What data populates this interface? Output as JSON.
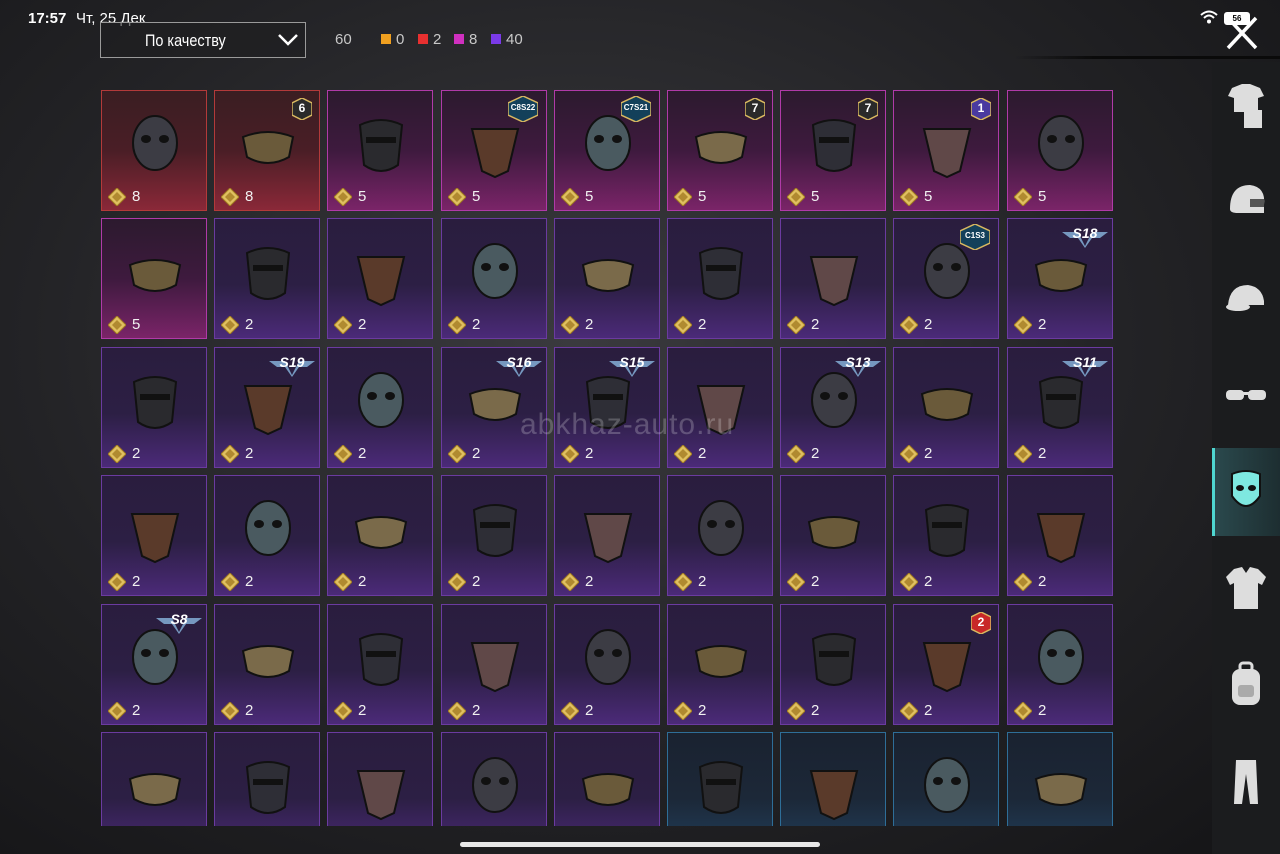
{
  "status_bar": {
    "time": "17:57",
    "date": "Чт, 25 Дек",
    "battery": "56"
  },
  "sort": {
    "label": "По качеству"
  },
  "counts": {
    "total": "60",
    "legendary": "0",
    "red": "2",
    "pink": "8",
    "purple": "40",
    "colors": {
      "legendary": "#f0a020",
      "red": "#e83030",
      "pink": "#d030c0",
      "purple": "#7a3ae8"
    }
  },
  "watermark": "abkhaz-auto.ru",
  "items": [
    {
      "name": "gas-mask-yellow-eyes",
      "rarity": "red",
      "price": "8"
    },
    {
      "name": "plague-doctor-mask",
      "rarity": "red",
      "price": "8",
      "badge": {
        "type": "num",
        "text": "6"
      }
    },
    {
      "name": "gold-face-mask",
      "rarity": "pink",
      "price": "5"
    },
    {
      "name": "black-ring-face-mask",
      "rarity": "pink",
      "price": "5",
      "badge": {
        "type": "season",
        "text": "C8S22"
      }
    },
    {
      "name": "tech-face-mask",
      "rarity": "pink",
      "price": "5",
      "badge": {
        "type": "season",
        "text": "C7S21"
      }
    },
    {
      "name": "earpiece-headset",
      "rarity": "pink",
      "price": "5",
      "badge": {
        "type": "num",
        "text": "7"
      }
    },
    {
      "name": "gold-purple-mask",
      "rarity": "pink",
      "price": "5",
      "badge": {
        "type": "num",
        "text": "7"
      }
    },
    {
      "name": "steel-skull-helmet",
      "rarity": "pink",
      "price": "5",
      "badge": {
        "type": "num",
        "text": "1"
      }
    },
    {
      "name": "beaked-mask-goggles",
      "rarity": "pink",
      "price": "5"
    },
    {
      "name": "skull-bandana",
      "rarity": "pink",
      "price": "5"
    },
    {
      "name": "gold-masquerade-mask",
      "rarity": "purple",
      "price": "2"
    },
    {
      "name": "black-face-mask",
      "rarity": "purple",
      "price": "2"
    },
    {
      "name": "worn-cloth-mask",
      "rarity": "purple",
      "price": "2"
    },
    {
      "name": "orange-tactical-mask",
      "rarity": "purple",
      "price": "2"
    },
    {
      "name": "red-eye-visor",
      "rarity": "purple",
      "price": "2"
    },
    {
      "name": "neon-respirator",
      "rarity": "purple",
      "price": "2"
    },
    {
      "name": "green-cross-bandana",
      "rarity": "purple",
      "price": "2",
      "badge": {
        "type": "season",
        "text": "C1S3"
      }
    },
    {
      "name": "neon-graffiti-mask",
      "rarity": "purple",
      "price": "2",
      "badge": {
        "type": "wing",
        "text": "S18"
      }
    },
    {
      "name": "white-hockey-mask",
      "rarity": "purple",
      "price": "2"
    },
    {
      "name": "cyan-visor-goggles",
      "rarity": "purple",
      "price": "2",
      "badge": {
        "type": "wing",
        "text": "S19"
      }
    },
    {
      "name": "grey-face-mask",
      "rarity": "purple",
      "price": "2"
    },
    {
      "name": "yellow-visor-mask",
      "rarity": "purple",
      "price": "2",
      "badge": {
        "type": "wing",
        "text": "S16"
      }
    },
    {
      "name": "gold-skull-helmet",
      "rarity": "purple",
      "price": "2",
      "badge": {
        "type": "wing",
        "text": "S15"
      }
    },
    {
      "name": "dark-masquerade-mask",
      "rarity": "purple",
      "price": "2"
    },
    {
      "name": "aviator-goggle-helmet",
      "rarity": "purple",
      "price": "2",
      "badge": {
        "type": "wing",
        "text": "S13"
      }
    },
    {
      "name": "black-half-mask",
      "rarity": "purple",
      "price": "2"
    },
    {
      "name": "red-half-mask",
      "rarity": "purple",
      "price": "2",
      "badge": {
        "type": "wing",
        "text": "S11"
      }
    },
    {
      "name": "black-balaclava",
      "rarity": "purple",
      "price": "2"
    },
    {
      "name": "plaid-wrap-mask",
      "rarity": "purple",
      "price": "2"
    },
    {
      "name": "visor-helmet",
      "rarity": "purple",
      "price": "2"
    },
    {
      "name": "mummy-wrap-mask",
      "rarity": "purple",
      "price": "2"
    },
    {
      "name": "leather-jaw-mask",
      "rarity": "purple",
      "price": "2"
    },
    {
      "name": "white-bandana",
      "rarity": "purple",
      "price": "2"
    },
    {
      "name": "blue-bandana",
      "rarity": "purple",
      "price": "2"
    },
    {
      "name": "battle-half-mask",
      "rarity": "purple",
      "price": "2"
    },
    {
      "name": "brown-hair-wig",
      "rarity": "purple",
      "price": "2"
    },
    {
      "name": "flame-hood",
      "rarity": "purple",
      "price": "2",
      "badge": {
        "type": "wing",
        "text": "S8"
      }
    },
    {
      "name": "studded-mask",
      "rarity": "purple",
      "price": "2"
    },
    {
      "name": "pixel-heart-glasses",
      "rarity": "purple",
      "price": "2"
    },
    {
      "name": "grin-face-mask",
      "rarity": "purple",
      "price": "2"
    },
    {
      "name": "orange-hockey-mask",
      "rarity": "purple",
      "price": "2"
    },
    {
      "name": "flag-hockey-mask",
      "rarity": "purple",
      "price": "2"
    },
    {
      "name": "teeth-face-mask",
      "rarity": "purple",
      "price": "2"
    },
    {
      "name": "orange-skull-mask",
      "rarity": "purple",
      "price": "2",
      "badge": {
        "type": "num2",
        "text": "2"
      }
    },
    {
      "name": "dark-skull-mask",
      "rarity": "purple",
      "price": "2"
    },
    {
      "name": "jaw-guard",
      "rarity": "purple"
    },
    {
      "name": "black-scarf",
      "rarity": "purple"
    },
    {
      "name": "red-neckerchief",
      "rarity": "purple"
    },
    {
      "name": "gold-sequin-mask",
      "rarity": "purple"
    },
    {
      "name": "iron-face-mask",
      "rarity": "purple"
    },
    {
      "name": "burlap-mask",
      "rarity": "blue"
    },
    {
      "name": "yellow-net-bandana",
      "rarity": "blue"
    },
    {
      "name": "web-bandana",
      "rarity": "blue"
    },
    {
      "name": "purple-theater-mask",
      "rarity": "blue"
    }
  ],
  "sidebar": [
    {
      "name": "outfit-icon"
    },
    {
      "name": "helmet-icon"
    },
    {
      "name": "cap-icon"
    },
    {
      "name": "glasses-icon"
    },
    {
      "name": "mask-icon",
      "active": true
    },
    {
      "name": "jacket-icon"
    },
    {
      "name": "backpack-icon"
    },
    {
      "name": "pants-icon"
    }
  ]
}
